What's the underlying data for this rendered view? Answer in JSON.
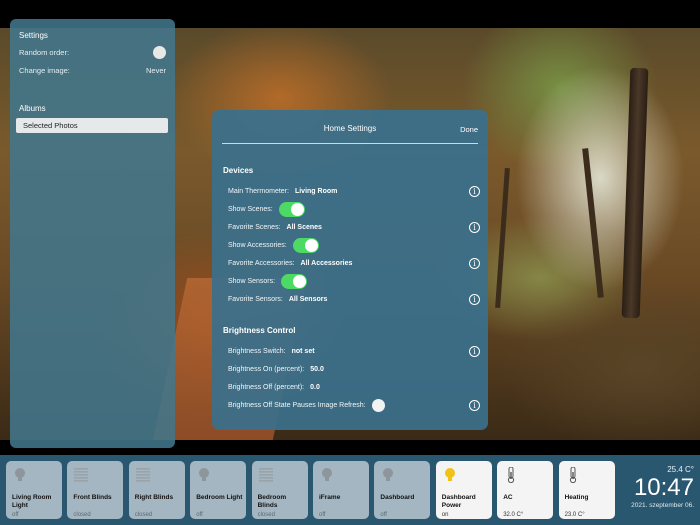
{
  "sidebar": {
    "title": "Settings",
    "random_order_label": "Random order:",
    "change_image_label": "Change image:",
    "change_image_value": "Never",
    "albums_label": "Albums",
    "album_selected": "Selected Photos"
  },
  "modal": {
    "title": "Home Settings",
    "done": "Done",
    "devices_header": "Devices",
    "main_thermometer_label": "Main Thermometer:",
    "main_thermometer_value": "Living Room",
    "show_scenes_label": "Show Scenes:",
    "show_scenes_on": true,
    "favorite_scenes_label": "Favorite Scenes:",
    "favorite_scenes_value": "All Scenes",
    "show_accessories_label": "Show Accessories:",
    "show_accessories_on": true,
    "favorite_accessories_label": "Favorite Accessories:",
    "favorite_accessories_value": "All Accessories",
    "show_sensors_label": "Show Sensors:",
    "show_sensors_on": true,
    "favorite_sensors_label": "Favorite Sensors:",
    "favorite_sensors_value": "All Sensors",
    "brightness_header": "Brightness Control",
    "brightness_switch_label": "Brightness Switch:",
    "brightness_switch_value": "not set",
    "brightness_on_label": "Brightness On (percent):",
    "brightness_on_value": "50.0",
    "brightness_off_label": "Brightness Off (percent):",
    "brightness_off_value": "0.0",
    "brightness_pause_label": "Brightness Off State Pauses Image Refresh:",
    "info_glyph": "i"
  },
  "tiles": [
    {
      "name": "Living Room Light",
      "state": "off",
      "icon": "bulb-icon",
      "on": false
    },
    {
      "name": "Front Blinds",
      "state": "closed",
      "icon": "blinds-icon",
      "on": false
    },
    {
      "name": "Right Blinds",
      "state": "closed",
      "icon": "blinds-icon",
      "on": false
    },
    {
      "name": "Bedroom Light",
      "state": "off",
      "icon": "bulb-icon",
      "on": false
    },
    {
      "name": "Bedroom Blinds",
      "state": "closed",
      "icon": "blinds-icon",
      "on": false
    },
    {
      "name": "iFrame",
      "state": "off",
      "icon": "bulb-icon",
      "on": false
    },
    {
      "name": "Dashboard",
      "state": "off",
      "icon": "bulb-icon",
      "on": false
    },
    {
      "name": "Dashboard Power",
      "state": "on",
      "icon": "bulb-icon",
      "on": true
    },
    {
      "name": "AC",
      "state": "32.0 C°",
      "icon": "thermometer-icon",
      "on": true
    },
    {
      "name": "Heating",
      "state": "23.0 C°",
      "icon": "thermometer-icon",
      "on": true
    }
  ],
  "clock": {
    "temperature": "25.4 C°",
    "time": "10:47",
    "date": "2021. szeptember 06."
  },
  "colors": {
    "toggle_on": "#4cd964",
    "bulb_on": "#f0c21a"
  }
}
